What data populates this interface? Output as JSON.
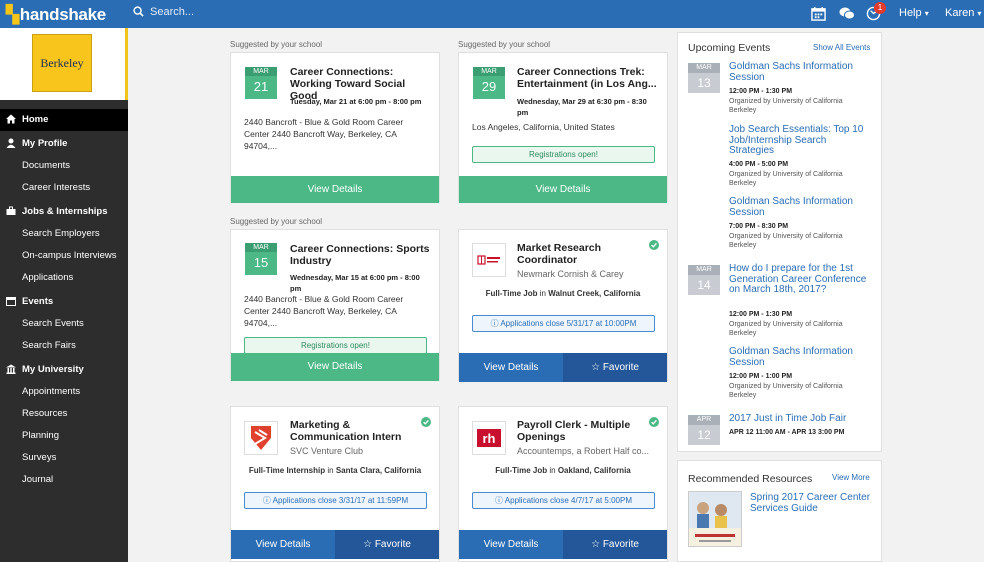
{
  "topbar": {
    "logo": "handshake",
    "search_placeholder": "Search...",
    "notification_count": "1",
    "help_label": "Help",
    "user_label": "Karen",
    "caret": "▾"
  },
  "sidebar": {
    "school_logo_text": "Berkeley",
    "items": [
      {
        "label": "Home"
      },
      {
        "label": "My Profile"
      },
      {
        "label": "Documents"
      },
      {
        "label": "Career Interests"
      },
      {
        "label": "Jobs & Internships"
      },
      {
        "label": "Search Employers"
      },
      {
        "label": "On-campus Interviews"
      },
      {
        "label": "Applications"
      },
      {
        "label": "Events"
      },
      {
        "label": "Search Events"
      },
      {
        "label": "Search Fairs"
      },
      {
        "label": "My University"
      },
      {
        "label": "Appointments"
      },
      {
        "label": "Resources"
      },
      {
        "label": "Planning"
      },
      {
        "label": "Surveys"
      },
      {
        "label": "Journal"
      }
    ]
  },
  "feed": {
    "suggested_label": "Suggested by your school",
    "view_details": "View Details",
    "favorite": "Favorite",
    "registrations_open": "Registrations open!",
    "events": [
      {
        "month": "MAR",
        "day": "21",
        "title": "Career Connections: Working Toward Social Good",
        "datetime": "Tuesday, Mar 21 at 6:00 pm - 8:00 pm",
        "address": "2440 Bancroft - Blue & Gold Room Career Center 2440 Bancroft Way, Berkeley, CA 94704,..."
      },
      {
        "month": "MAR",
        "day": "29",
        "title": "Career Connections Trek: Entertainment (in Los Ang...",
        "datetime": "Wednesday, Mar 29 at 6:30 pm - 8:30 pm",
        "address": "Los Angeles, California, United States"
      },
      {
        "month": "MAR",
        "day": "15",
        "title": "Career Connections: Sports Industry",
        "datetime": "Wednesday, Mar 15 at 6:00 pm - 8:00 pm",
        "address": "2440 Bancroft - Blue & Gold Room Career Center 2440 Bancroft Way, Berkeley, CA 94704,..."
      }
    ],
    "jobs": [
      {
        "title": "Market Research Coordinator",
        "company": "Newmark Cornish & Carey",
        "type": "Full-Time Job",
        "in": "in",
        "location": "Walnut Creek, California",
        "closes": "Applications close 5/31/17 at 10:00PM"
      },
      {
        "title": "Marketing & Communication Intern",
        "company": "SVC Venture Club",
        "type": "Full-Time Internship",
        "in": "in",
        "location": "Santa Clara, California",
        "closes": "Applications close 3/31/17 at 11:59PM"
      },
      {
        "title": "Payroll Clerk - Multiple Openings",
        "company": "Accountemps, a Robert Half co...",
        "type": "Full-Time Job",
        "in": "in",
        "location": "Oakland, California",
        "closes": "Applications close 4/7/17 at 5:00PM"
      }
    ]
  },
  "upcoming": {
    "heading": "Upcoming Events",
    "show_all": "Show All Events",
    "groups": [
      {
        "month": "MAR",
        "day": "13"
      },
      {
        "month": "MAR",
        "day": "14"
      },
      {
        "month": "APR",
        "day": "12"
      }
    ],
    "events": [
      {
        "title": "Goldman Sachs Information Session",
        "time": "12:00 PM - 1:30 PM",
        "org": "Organized by University of California Berkeley"
      },
      {
        "title": "Job Search Essentials: Top 10 Job/Internship Search Strategies",
        "time": "4:00 PM - 5:00 PM",
        "org": "Organized by University of California Berkeley"
      },
      {
        "title": "Goldman Sachs Information Session",
        "time": "7:00 PM - 8:30 PM",
        "org": "Organized by University of California Berkeley"
      },
      {
        "title": "How do I prepare for the 1st Generation Career Conference on March 18th, 2017?",
        "time": "12:00 PM - 1:30 PM",
        "org": "Organized by University of California Berkeley"
      },
      {
        "title": "Goldman Sachs Information Session",
        "time": "12:00 PM - 1:00 PM",
        "org": "Organized by University of California Berkeley"
      },
      {
        "title": "2017 Just in Time Job Fair",
        "time": "APR 12 11:00 AM - APR 13 3:00 PM"
      }
    ]
  },
  "resources": {
    "heading": "Recommended Resources",
    "view_more": "View More",
    "item_title": "Spring 2017 Career Center Services Guide"
  },
  "colors": {
    "brand_blue": "#2a6db4",
    "green": "#4bb886",
    "sidebar": "#2d2d2d",
    "berkeley_gold": "#f7c51b"
  }
}
